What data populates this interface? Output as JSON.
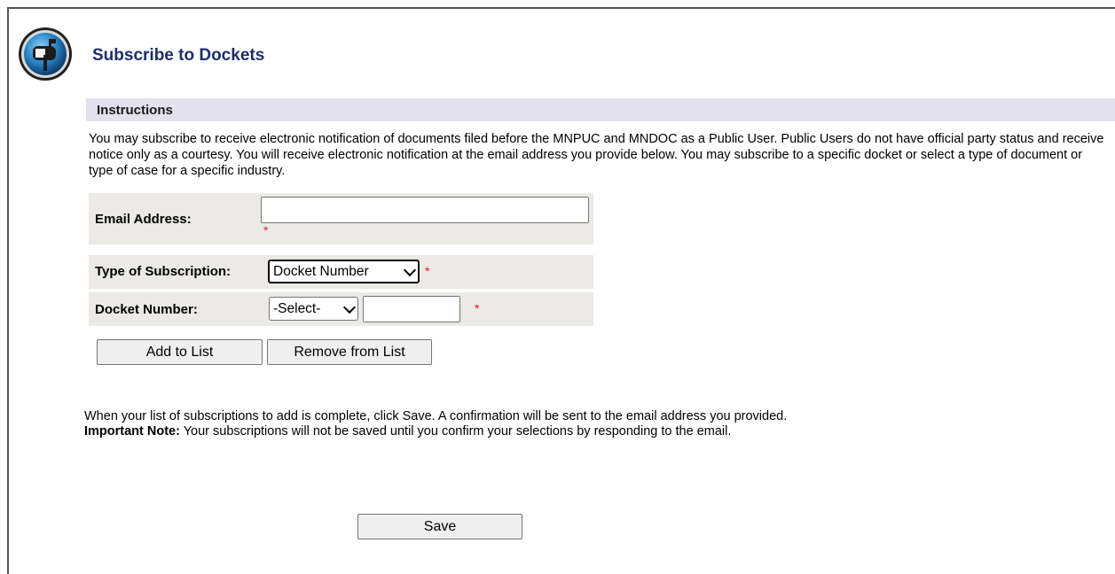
{
  "page": {
    "title": "Subscribe to Dockets"
  },
  "instructions": {
    "heading": "Instructions",
    "text": "You may subscribe to receive electronic notification of documents filed before the MNPUC and MNDOC as a Public User. Public Users do not have official party status and receive notice only as a courtesy. You will receive electronic notification at the email address you provide below. You may subscribe to a specific docket or select a type of document or type of case for a specific industry."
  },
  "form": {
    "email_label": "Email Address:",
    "email_value": "",
    "required_mark": "*",
    "subscription_type_label": "Type of Subscription:",
    "subscription_type_value": "Docket Number",
    "docket_number_label": "Docket Number:",
    "docket_select_value": "-Select-",
    "docket_number_value": ""
  },
  "buttons": {
    "add_to_list": "Add to List",
    "remove_from_list": "Remove from List",
    "save": "Save"
  },
  "note": {
    "line1": "When your list of subscriptions to add is complete, click Save. A confirmation will be sent to the email address you provided.",
    "important_label": "Important Note:",
    "important_text": " Your subscriptions will not be saved until you confirm your selections by responding to the email."
  },
  "icons": {
    "logo": "mailbox-icon"
  }
}
